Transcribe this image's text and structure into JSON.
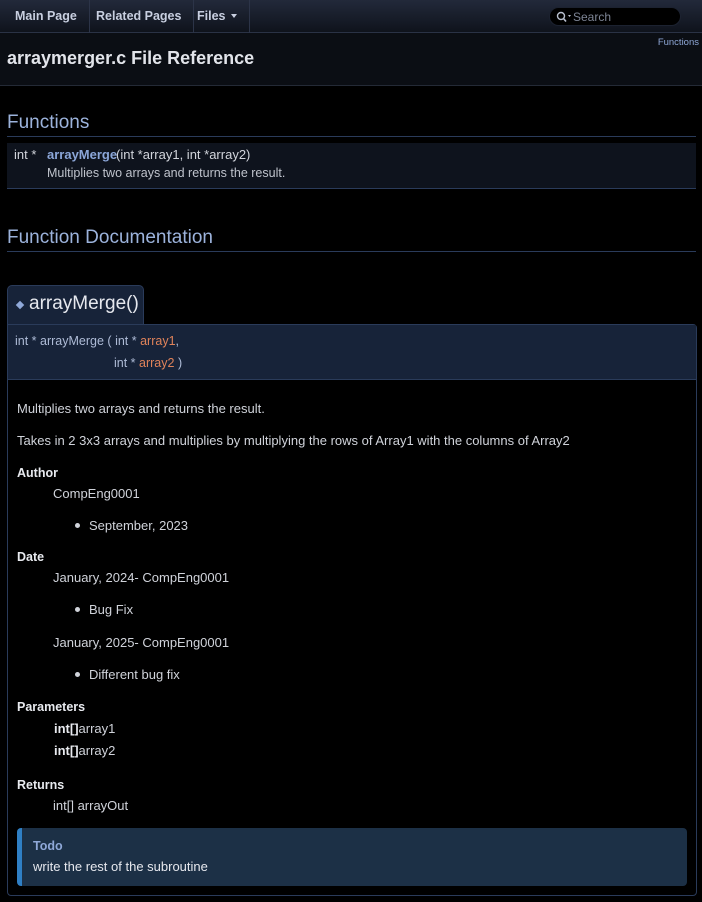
{
  "nav": {
    "items": [
      {
        "label": "Main Page"
      },
      {
        "label": "Related Pages"
      },
      {
        "label": "Files"
      }
    ],
    "search_placeholder": "Search"
  },
  "header": {
    "summary_link": "Functions",
    "title": "arraymerger.c File Reference"
  },
  "functions_section": {
    "heading": "Functions",
    "members": [
      {
        "type": "int *",
        "name": "arrayMerge",
        "args": "(int *array1, int *array2)",
        "brief": "Multiplies two arrays and returns the result."
      }
    ]
  },
  "documentation_section": {
    "heading": "Function Documentation",
    "function": {
      "title": "arrayMerge()",
      "proto_return": "int * arrayMerge",
      "params": [
        {
          "type": "int *",
          "name": "array1",
          "sep": ","
        },
        {
          "type": "int *",
          "name": "array2",
          "sep": ")"
        }
      ],
      "open_paren": "(",
      "brief": "Multiplies two arrays and returns the result.",
      "details": "Takes in 2 3x3 arrays and multiplies by multiplying the rows of Array1 with the columns of Array2",
      "author_label": "Author",
      "author": "CompEng0001",
      "author_items": [
        "September, 2023"
      ],
      "date_label": "Date",
      "date_entries": [
        {
          "text": "January, 2024- CompEng0001",
          "items": [
            "Bug Fix"
          ]
        },
        {
          "text": "January, 2025- CompEng0001",
          "items": [
            "Different bug fix"
          ]
        }
      ],
      "parameters_label": "Parameters",
      "parameters": [
        {
          "type": "int[]",
          "name": "array1"
        },
        {
          "type": "int[]",
          "name": "array2"
        }
      ],
      "returns_label": "Returns",
      "returns": "int[] arrayOut",
      "todo_title": "Todo",
      "todo_text": "write the rest of the subroutine"
    }
  },
  "colors": {
    "background": "#000000",
    "heading": "#9cb3dc",
    "link": "#8ba6d8",
    "param": "#e0835a",
    "todo_accent": "#2f7fc4"
  }
}
